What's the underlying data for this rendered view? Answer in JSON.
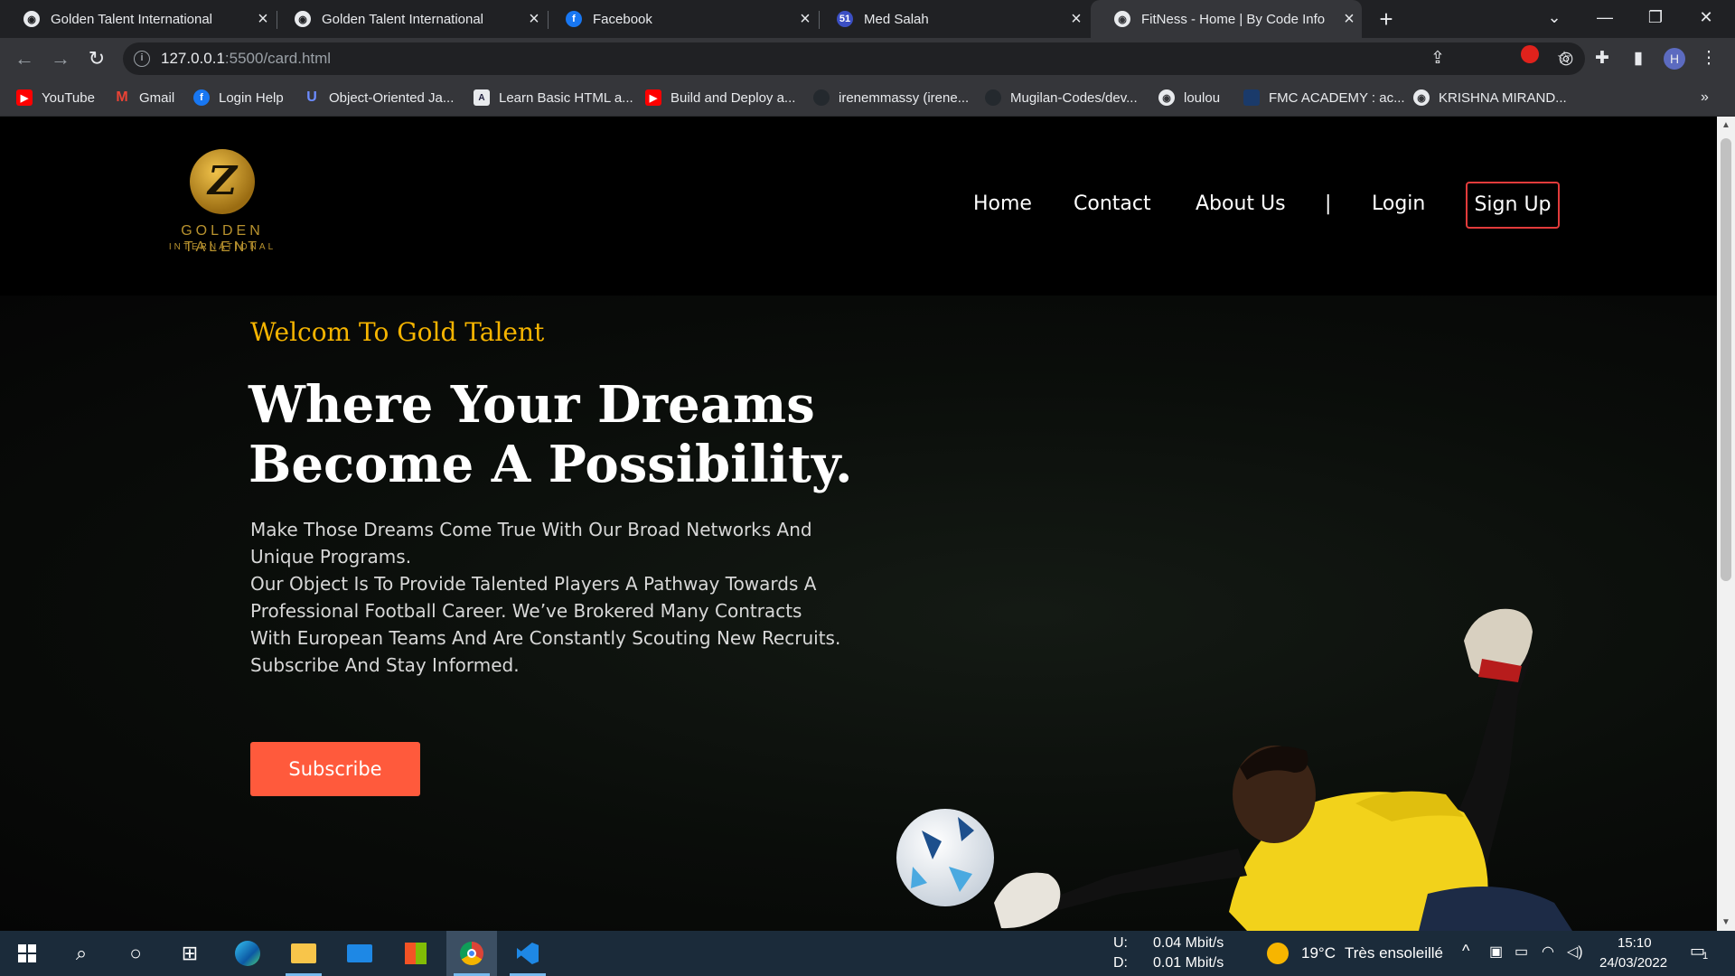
{
  "browser": {
    "tabs": [
      {
        "title": "Golden Talent International",
        "icon": "globe-icon",
        "active": false
      },
      {
        "title": "Golden Talent International",
        "icon": "globe-icon",
        "active": false
      },
      {
        "title": "Facebook",
        "icon": "facebook-icon",
        "active": false
      },
      {
        "title": "Med Salah",
        "icon": "badge-51-icon",
        "active": false,
        "badge": "51"
      },
      {
        "title": "FitNess - Home | By Code Info",
        "icon": "globe-icon",
        "active": true
      }
    ],
    "address": {
      "host": "127.0.0.1",
      "path": ":5500/card.html"
    },
    "profile_initial": "H",
    "bookmarks": [
      {
        "label": "YouTube",
        "icon": "youtube-icon",
        "color": "#ff0000"
      },
      {
        "label": "Gmail",
        "icon": "gmail-icon",
        "color": "#ea4335"
      },
      {
        "label": "Login Help",
        "icon": "facebook-icon",
        "color": "#1877f2"
      },
      {
        "label": "Object-Oriented Ja...",
        "icon": "udemy-icon",
        "color": "#5624d0"
      },
      {
        "label": "Learn Basic HTML a...",
        "icon": "code-icon",
        "color": "#1e1e3c"
      },
      {
        "label": "Build and Deploy a...",
        "icon": "youtube-icon",
        "color": "#ff0000"
      },
      {
        "label": "irenemmassy (irene...",
        "icon": "github-icon",
        "color": "#24292e"
      },
      {
        "label": "Mugilan-Codes/dev...",
        "icon": "github-icon",
        "color": "#24292e"
      },
      {
        "label": "loulou",
        "icon": "globe-icon",
        "color": "#5f6368"
      },
      {
        "label": "FMC ACADEMY : ac...",
        "icon": "site-icon",
        "color": "#1a3a6a"
      },
      {
        "label": "KRISHNA MIRAND...",
        "icon": "globe-icon",
        "color": "#5f6368"
      }
    ]
  },
  "site": {
    "logo": {
      "line1": "GOLDEN TALENT",
      "line2": "INTERNATIONAL"
    },
    "nav": {
      "home": "Home",
      "contact": "Contact",
      "about": "About Us",
      "separator": "|",
      "login": "Login",
      "signup": "Sign Up"
    },
    "hero": {
      "welcome": "Welcom To Gold Talent",
      "headline_line1": "Where Your Dreams",
      "headline_line2": "Become A Possibility.",
      "p1": "Make Those Dreams Come True With Our Broad Networks And Unique Programs.",
      "p2": "Our Object Is To Provide Talented Players A Pathway Towards A Professional Football Career. We’ve Brokered Many Contracts With European Teams And Are Constantly Scouting New Recruits.",
      "p3": "Subscribe And Stay Informed.",
      "cta": "Subscribe"
    },
    "colors": {
      "accent": "#f5b400",
      "cta": "#ff5a3c",
      "signup_border": "#e23b3b"
    }
  },
  "taskbar": {
    "network": {
      "up_label": "U:",
      "up_value": "0.04 Mbit/s",
      "down_label": "D:",
      "down_value": "0.01 Mbit/s"
    },
    "weather": {
      "temp": "19°C",
      "desc": "Très ensoleillé"
    },
    "clock": {
      "time": "15:10",
      "date": "24/03/2022"
    },
    "notifications": "1"
  }
}
